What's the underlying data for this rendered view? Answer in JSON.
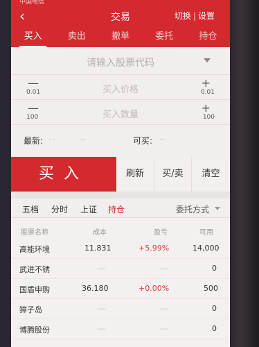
{
  "status_bar": {
    "carrier": "中国电信"
  },
  "header": {
    "title": "交易",
    "switch_label": "切换",
    "separator": "|",
    "settings_label": "设置"
  },
  "tabs": [
    {
      "label": "买入"
    },
    {
      "label": "卖出"
    },
    {
      "label": "撤单"
    },
    {
      "label": "委托"
    },
    {
      "label": "持仓"
    }
  ],
  "form": {
    "code_placeholder": "请输入股票代码",
    "price_placeholder": "买入价格",
    "price_minus": "—",
    "price_minus_step": "0.01",
    "price_plus": "+",
    "price_plus_step": "0.01",
    "qty_placeholder": "买入数量",
    "qty_minus": "—",
    "qty_minus_step": "100",
    "qty_plus": "+",
    "qty_plus_step": "100",
    "latest_label": "最新:",
    "latest_value": "--",
    "latest_change": "--",
    "available_label": "可买:",
    "available_value": "--"
  },
  "actions": {
    "buy": "买入",
    "refresh": "刷新",
    "buy_sell": "买/卖",
    "clear": "清空"
  },
  "subtabs": {
    "items": [
      "五档",
      "分时",
      "上证",
      "持仓"
    ],
    "active": "持仓",
    "order_method": "委托方式"
  },
  "table": {
    "headers": [
      "股票名称",
      "成本",
      "盈亏",
      "可用"
    ],
    "rows": [
      {
        "name": "高能环境",
        "cost": "11.831",
        "pnl": "+5.99%",
        "avail": "14,000"
      },
      {
        "name": "武进不锈",
        "cost": "---",
        "pnl": "---",
        "avail": "0"
      },
      {
        "name": "国盾申购",
        "cost": "36.180",
        "pnl": "+0.00%",
        "avail": "500"
      },
      {
        "name": "獐子岛",
        "cost": "---",
        "pnl": "---",
        "avail": "0"
      },
      {
        "name": "博腾股份",
        "cost": "---",
        "pnl": "---",
        "avail": "0"
      }
    ]
  },
  "colors": {
    "brand_red": "#d42a2f",
    "positive": "#e0403f",
    "background": "#f3eeee"
  }
}
